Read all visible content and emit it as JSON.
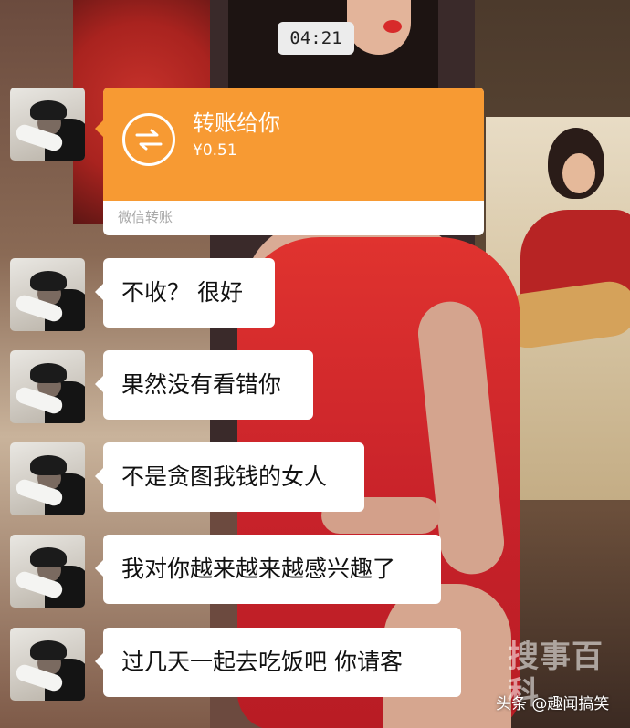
{
  "status": {
    "time": "04:21"
  },
  "transfer": {
    "title": "转账给你",
    "amount": "¥0.51",
    "footer": "微信转账",
    "icon": "transfer-arrows-icon",
    "color": "#f79a33"
  },
  "messages": [
    {
      "text": "不收？  很好"
    },
    {
      "text": "果然没有看错你"
    },
    {
      "text": "不是贪图我钱的女人"
    },
    {
      "text": "我对你越来越来越感兴趣了"
    },
    {
      "text": "过几天一起去吃饭吧  你请客"
    }
  ],
  "watermark": {
    "logo": "搜事百科",
    "credit": "头条 @趣闻搞笑"
  },
  "colors": {
    "bubble": "#ffffff",
    "time_badge": "#ececec"
  }
}
